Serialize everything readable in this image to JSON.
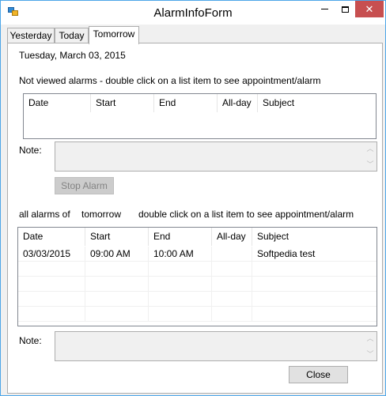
{
  "window": {
    "title": "AlarmInfoForm",
    "minimize_label": "",
    "close_glyph": "✕"
  },
  "tabs": [
    {
      "label": "Yesterday"
    },
    {
      "label": "Today"
    },
    {
      "label": "Tomorrow"
    }
  ],
  "date_heading": "Tuesday, March 03, 2015",
  "not_viewed": {
    "instruction": "Not viewed alarms - double click on a list item to see appointment/alarm",
    "columns": [
      "Date",
      "Start",
      "End",
      "All-day",
      "Subject"
    ]
  },
  "note1": {
    "label": "Note:",
    "value": ""
  },
  "stop_alarm_label": "Stop Alarm",
  "all_alarms": {
    "prefix": "all alarms of",
    "period": "tomorrow",
    "instruction": "double click on a list item to see appointment/alarm",
    "columns": [
      "Date",
      "Start",
      "End",
      "All-day",
      "Subject"
    ],
    "rows": [
      {
        "date": "03/03/2015",
        "start": "09:00 AM",
        "end": "10:00 AM",
        "allday": "",
        "subject": "Softpedia test"
      }
    ]
  },
  "note2": {
    "label": "Note:",
    "value": ""
  },
  "close_button_label": "Close"
}
